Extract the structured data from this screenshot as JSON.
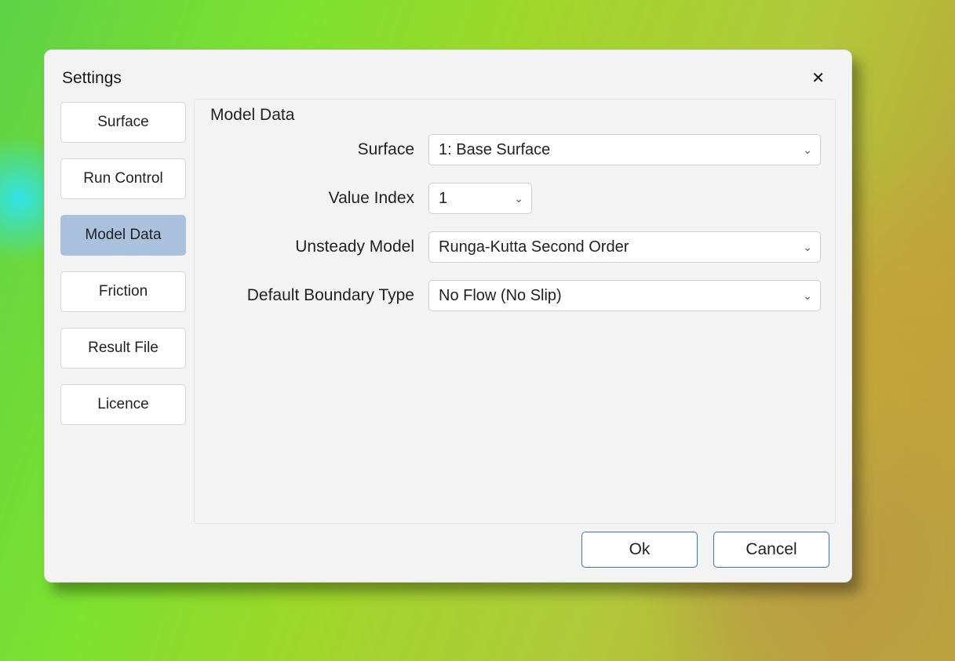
{
  "dialog": {
    "title": "Settings",
    "close_icon": "✕"
  },
  "sidebar": {
    "items": [
      {
        "label": "Surface",
        "id": "nav-surface"
      },
      {
        "label": "Run Control",
        "id": "nav-run-control"
      },
      {
        "label": "Model Data",
        "id": "nav-model-data",
        "active": true
      },
      {
        "label": "Friction",
        "id": "nav-friction"
      },
      {
        "label": "Result File",
        "id": "nav-result-file"
      },
      {
        "label": "Licence",
        "id": "nav-licence"
      }
    ]
  },
  "panel": {
    "title": "Model Data",
    "fields": {
      "surface": {
        "label": "Surface",
        "value": "1: Base Surface"
      },
      "value_index": {
        "label": "Value Index",
        "value": "1"
      },
      "unsteady_model": {
        "label": "Unsteady Model",
        "value": "Runga-Kutta Second Order"
      },
      "default_boundary_type": {
        "label": "Default Boundary Type",
        "value": "No Flow (No Slip)"
      }
    }
  },
  "footer": {
    "ok_label": "Ok",
    "cancel_label": "Cancel"
  }
}
